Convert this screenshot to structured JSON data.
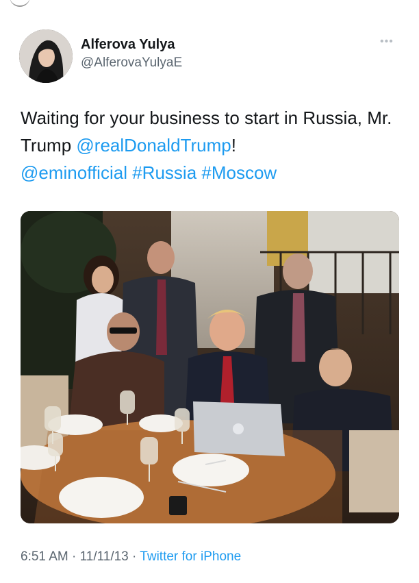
{
  "tweet": {
    "display_name": "Alferova Yulya",
    "handle": "@AlferovaYulyaE",
    "text_part1": "Waiting for your business to start in Russia, Mr. Trump ",
    "mention_trump": "@realDonaldTrump",
    "text_part2": "! ",
    "mention_emin": "@eminofficial",
    "hashtag_russia": "#Russia",
    "hashtag_moscow": "#Moscow",
    "time": "6:51 AM",
    "date": "11/11/13",
    "separator": "·",
    "source": "Twitter for iPhone"
  },
  "icons": {
    "more": "more-dots-icon"
  },
  "colors": {
    "link": "#1d9bf0",
    "text": "#14171a",
    "secondary": "#5b6670"
  }
}
